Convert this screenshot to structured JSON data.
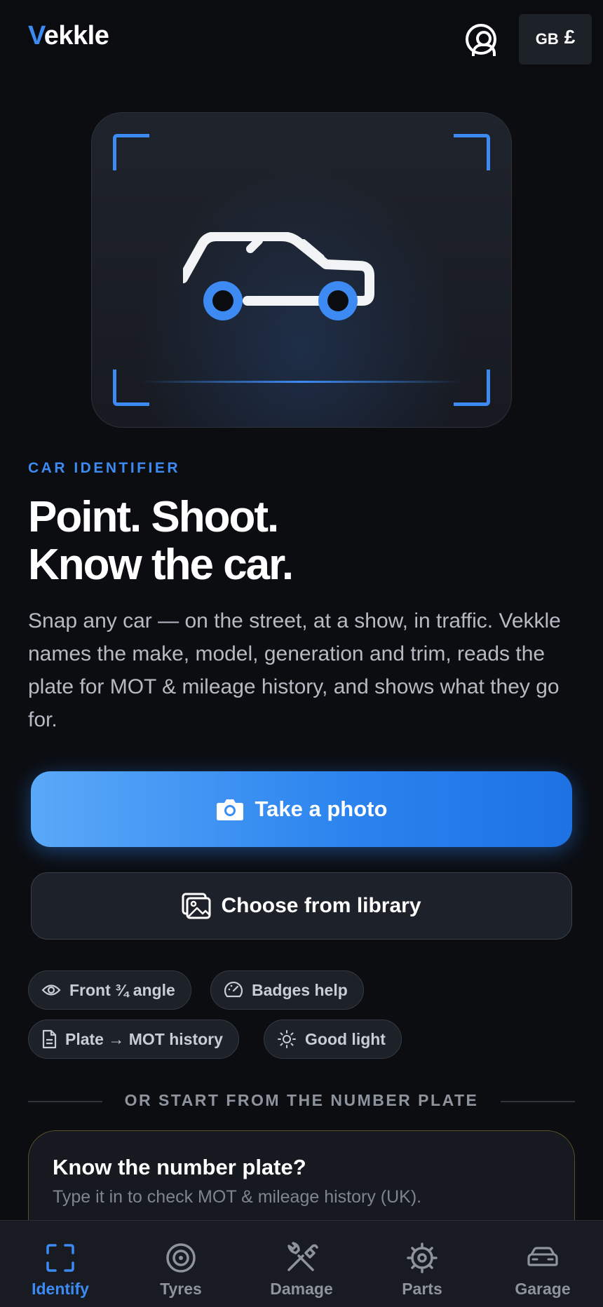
{
  "header": {
    "logo_initial": "V",
    "logo_rest": "ekkle",
    "region_code": "GB",
    "currency_symbol": "£",
    "profile_icon": "account-circle-icon"
  },
  "hero": {
    "eyebrow": "CAR IDENTIFIER",
    "headline_line1": "Point. Shoot.",
    "headline_line2": "Know the car.",
    "description": "Snap any car — on the street, at a show, in traffic. Vekkle names the make, model, generation and trim, reads the plate for MOT & mileage history, and shows what they go for."
  },
  "actions": {
    "primary_label": "Take a photo",
    "primary_icon": "camera-icon",
    "secondary_label": "Choose from library",
    "secondary_icon": "image-gallery-icon"
  },
  "tips": [
    {
      "label": "Front ¾ angle",
      "icon": "eye-icon"
    },
    {
      "label": "Badges help",
      "icon": "gauge-icon"
    },
    {
      "label": "Plate → MOT history",
      "icon": "document-icon"
    },
    {
      "label": "Good light",
      "icon": "sun-icon"
    }
  ],
  "divider_text": "OR START FROM THE NUMBER PLATE",
  "plate_card": {
    "title": "Know the number plate?",
    "subtitle": "Type it in to check MOT & mileage history (UK)."
  },
  "bottom_nav": [
    {
      "label": "Identify",
      "icon": "scan-frame-icon",
      "active": true
    },
    {
      "label": "Tyres",
      "icon": "tyre-icon",
      "active": false
    },
    {
      "label": "Damage",
      "icon": "tools-icon",
      "active": false
    },
    {
      "label": "Parts",
      "icon": "gear-icon",
      "active": false
    },
    {
      "label": "Garage",
      "icon": "car-front-icon",
      "active": false
    }
  ],
  "colors": {
    "accent": "#3d8bf2",
    "background": "#0b0d11",
    "card": "#1d2128",
    "plate_border": "#5a4f2a"
  }
}
